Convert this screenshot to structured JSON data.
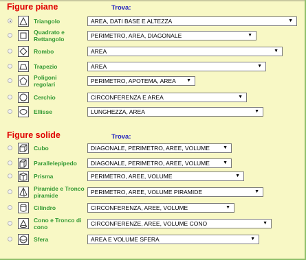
{
  "plane": {
    "title": "Figure piane",
    "trova": "Trova:",
    "rows": [
      {
        "label": "Triangolo",
        "value": "AREA, DATI BASE E ALTEZZA",
        "icon": "triangle-icon",
        "checked": true
      },
      {
        "label": "Quadrato e Rettangolo",
        "value": "PERIMETRO, AREA, DIAGONALE",
        "icon": "square-icon",
        "checked": false
      },
      {
        "label": "Rombo",
        "value": "AREA",
        "icon": "rhombus-icon",
        "checked": false
      },
      {
        "label": "Trapezio",
        "value": "AREA",
        "icon": "trapezoid-icon",
        "checked": false
      },
      {
        "label": "Poligoni regolari",
        "value": "PERIMETRO, APOTEMA, AREA",
        "icon": "pentagon-icon",
        "checked": false
      },
      {
        "label": "Cerchio",
        "value": "CIRCONFERENZA E AREA",
        "icon": "circle-icon",
        "checked": false
      },
      {
        "label": "Ellisse",
        "value": "LUNGHEZZA, AREA",
        "icon": "ellipse-icon",
        "checked": false
      }
    ]
  },
  "solid": {
    "title": "Figure solide",
    "trova": "Trova:",
    "rows": [
      {
        "label": "Cubo",
        "value": "DIAGONALE, PERIMETRO, AREE, VOLUME",
        "icon": "cube-icon",
        "checked": false
      },
      {
        "label": "Parallelepipedo",
        "value": "DIAGONALE, PERIMETRO, AREE, VOLUME",
        "icon": "cuboid-icon",
        "checked": false
      },
      {
        "label": "Prisma",
        "value": "PERIMETRO, AREE, VOLUME",
        "icon": "prism-icon",
        "checked": false
      },
      {
        "label": "Piramide e Tronco piramide",
        "value": "PERIMETRO, AREE, VOLUME PIRAMIDE",
        "icon": "pyramid-icon",
        "checked": false
      },
      {
        "label": "Cilindro",
        "value": "CIRCONFERENZA, AREE, VOLUME",
        "icon": "cylinder-icon",
        "checked": false
      },
      {
        "label": "Cono e Tronco di cono",
        "value": "CIRCONFERENZE, AREE, VOLUME CONO",
        "icon": "cone-icon",
        "checked": false
      },
      {
        "label": "Sfera",
        "value": "AREA E VOLUME SFERA",
        "icon": "sphere-icon",
        "checked": false
      }
    ]
  },
  "colors": {
    "background": "#f8f8c5",
    "section_title": "#e00000",
    "trova": "#2020c0",
    "label": "#339933"
  }
}
